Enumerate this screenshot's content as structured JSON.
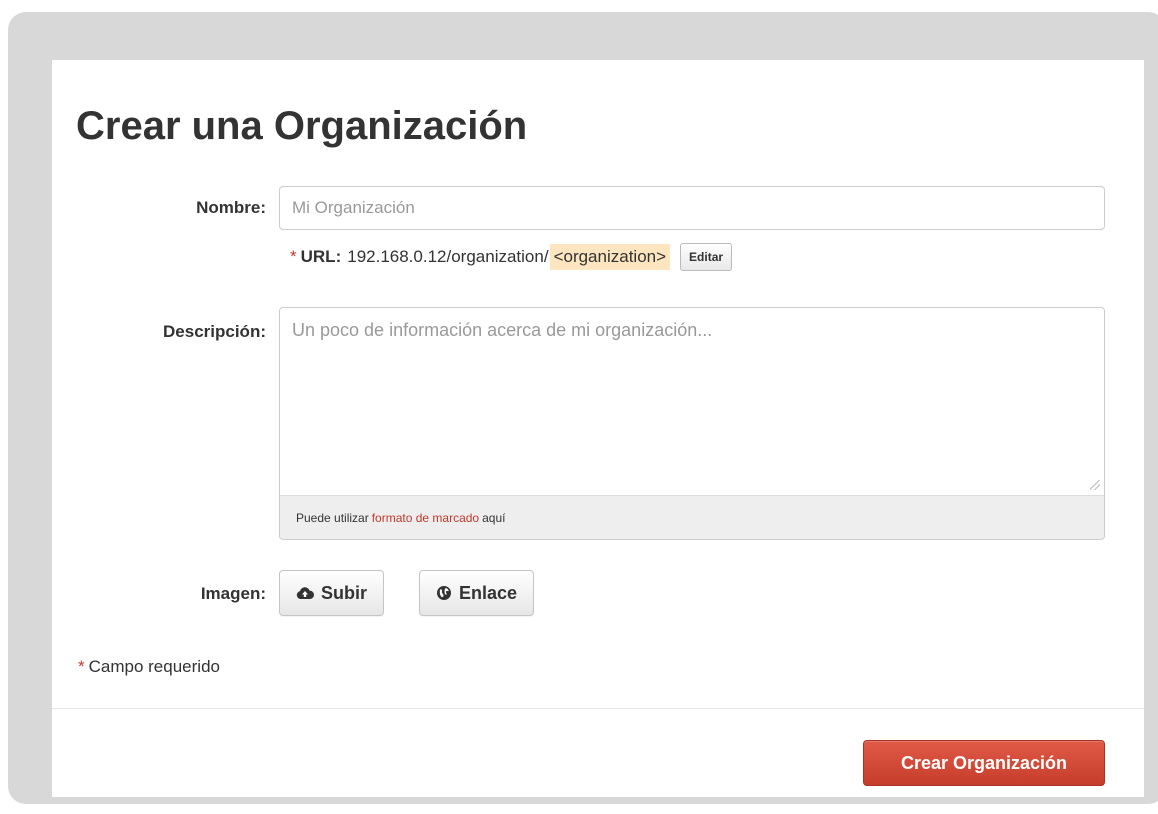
{
  "form": {
    "title": "Crear una Organización",
    "name": {
      "label": "Nombre:",
      "placeholder": "Mi Organización",
      "value": ""
    },
    "url": {
      "required_mark": "*",
      "label": "URL:",
      "base": "192.168.0.12/organization/",
      "slug": "<organization>",
      "edit_label": "Editar"
    },
    "description": {
      "label": "Descripción:",
      "placeholder": "Un poco de información acerca de mi organización...",
      "value": "",
      "help_prefix": "Puede utilizar",
      "help_link": "formato de marcado",
      "help_suffix": "aquí"
    },
    "image": {
      "label": "Imagen:",
      "upload_label": "Subir",
      "upload_icon": "cloud-upload-icon",
      "link_label": "Enlace",
      "link_icon": "globe-icon"
    },
    "required_note": {
      "mark": "*",
      "text": "Campo requerido"
    },
    "submit_label": "Crear Organización"
  },
  "colors": {
    "accent": "#c9412f",
    "required": "#c0392b",
    "slug_highlight": "#fce5bf",
    "frame": "#d8d8d8"
  }
}
